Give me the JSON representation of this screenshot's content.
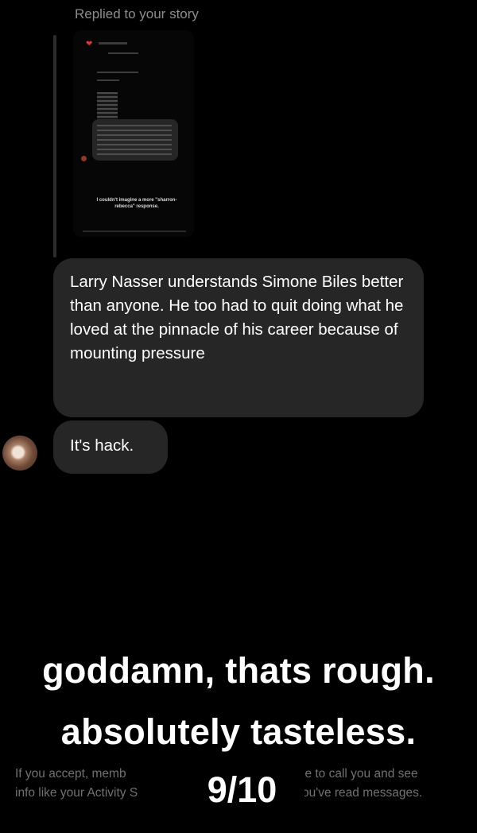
{
  "thread": {
    "replied_label": "Replied to your story",
    "story_caption": "I couldn't imagine a more \"sharron-rebecca\" response.",
    "messages": [
      {
        "text": "Larry Nasser understands Simone Biles better than anyone. He too had to quit doing what he loved at the pinnacle of his career because of mounting pressure"
      },
      {
        "text": "It's hack."
      }
    ]
  },
  "overlay": {
    "line1": "goddamn, thats rough.",
    "line2": "absolutely tasteless.",
    "score": "9/10"
  },
  "request_notice": {
    "left": "If you accept, memb\ninfo like your Activity S",
    "right": "le to call you and see\nou've read messages."
  },
  "colors": {
    "background": "#000000",
    "bubble": "#262626",
    "header_text": "#8d8d8d",
    "notice_text": "#717171"
  }
}
